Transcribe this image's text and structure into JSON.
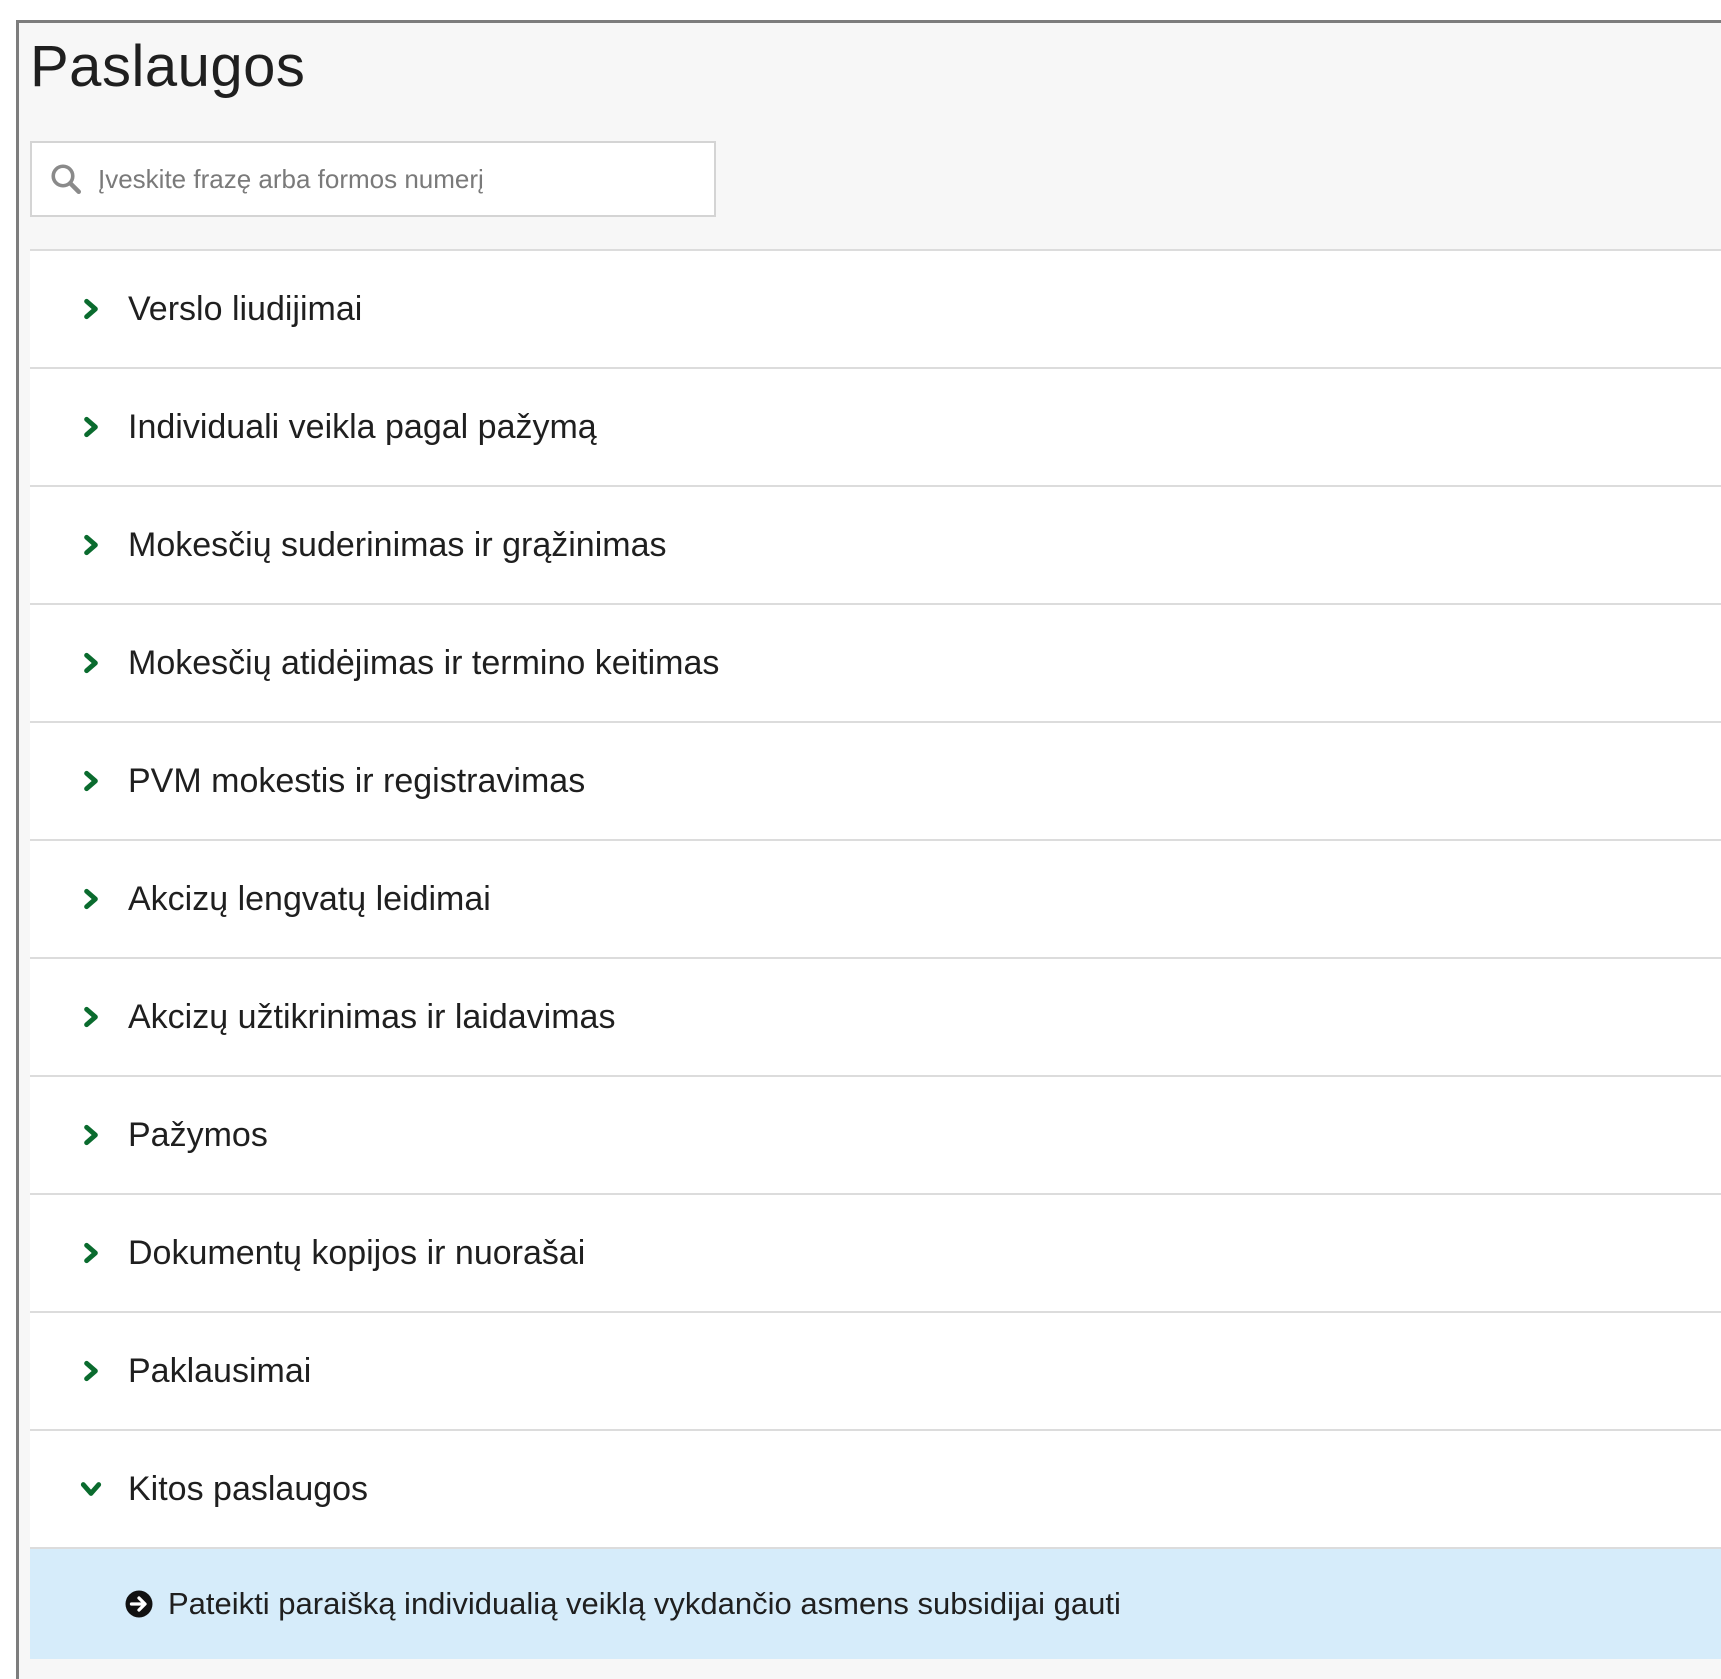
{
  "page": {
    "title": "Paslaugos"
  },
  "search": {
    "placeholder": "Įveskite frazę arba formos numerį",
    "value": ""
  },
  "accordion": {
    "items": [
      {
        "label": "Verslo liudijimai",
        "expanded": false
      },
      {
        "label": "Individuali veikla pagal pažymą",
        "expanded": false
      },
      {
        "label": "Mokesčių suderinimas ir grąžinimas",
        "expanded": false
      },
      {
        "label": "Mokesčių atidėjimas ir termino keitimas",
        "expanded": false
      },
      {
        "label": "PVM mokestis ir registravimas",
        "expanded": false
      },
      {
        "label": "Akcizų lengvatų leidimai",
        "expanded": false
      },
      {
        "label": "Akcizų užtikrinimas ir laidavimas",
        "expanded": false
      },
      {
        "label": "Pažymos",
        "expanded": false
      },
      {
        "label": "Dokumentų kopijos ir nuorašai",
        "expanded": false
      },
      {
        "label": "Paklausimai",
        "expanded": false
      },
      {
        "label": "Kitos paslaugos",
        "expanded": true
      }
    ],
    "expanded_children": [
      {
        "label": "Pateikti paraišką individualią veiklą vykdančio asmens subsidijai gauti"
      }
    ]
  },
  "colors": {
    "accent_green": "#0a6b2e",
    "highlight_blue": "#d6ecfa",
    "divider": "#dcdcdc"
  }
}
